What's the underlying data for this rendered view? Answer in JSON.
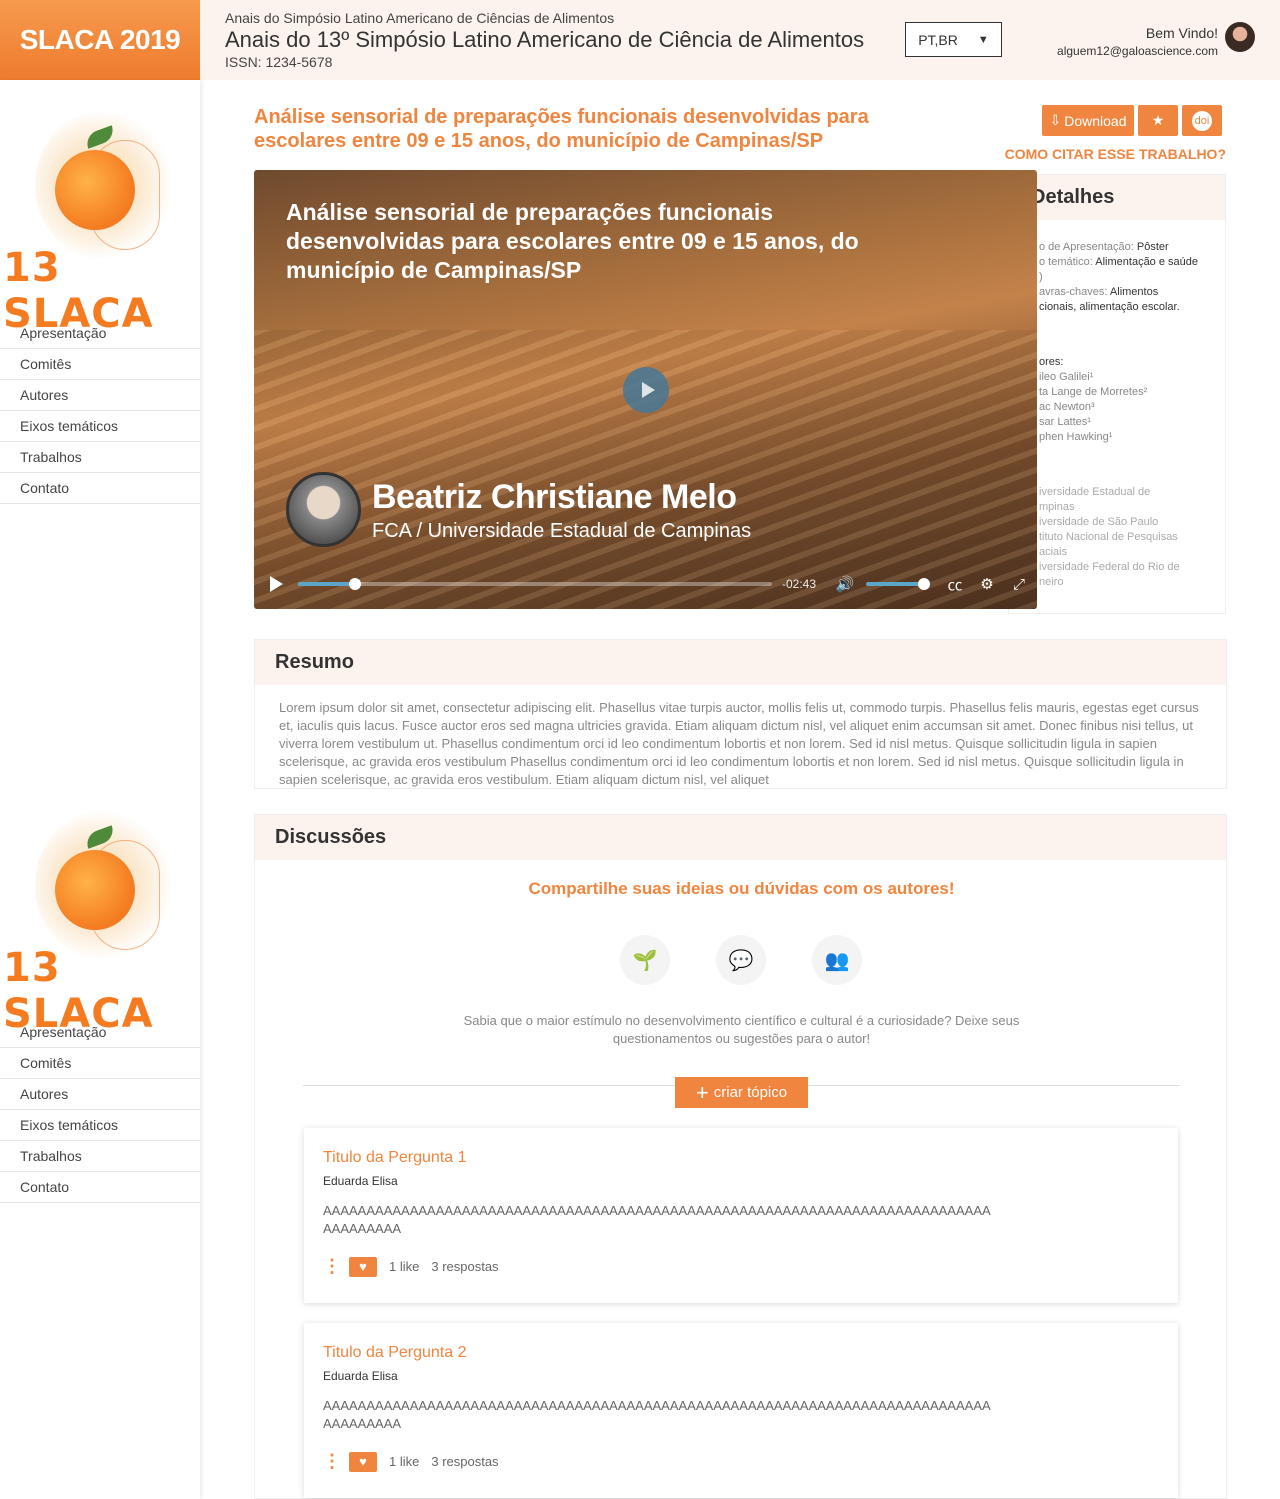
{
  "brand": {
    "name": "SLACA 2019"
  },
  "header": {
    "subtitle": "Anais do Simpósio Latino Americano de Ciências de Alimentos",
    "title": "Anais do 13º Simpósio Latino Americano de Ciência de Alimentos",
    "issn": "ISSN: 1234-5678",
    "language": "PT,BR",
    "welcome": "Bem Vindo!",
    "email": "alguem12@galoascience.com"
  },
  "sidebar": {
    "logo_text": "13 SLACA",
    "nav": [
      "Apresentação",
      "Comitês",
      "Autores",
      "Eixos temáticos",
      "Trabalhos",
      "Contato"
    ]
  },
  "paper": {
    "title": "Análise sensorial de preparações funcionais desenvolvidas para escolares entre 09 e 15 anos, do município de Campinas/SP",
    "download_label": "Download",
    "doi_label": "doi",
    "cite_label": "COMO CITAR ESSE TRABALHO?"
  },
  "details": {
    "title": "Detalhes",
    "line1_label": "o de Apresentação: ",
    "line1_value": "Pôster",
    "line2_label": "o temático: ",
    "line2_value": "Alimentação e saúde",
    "line2b": ")",
    "line3_label": "avras-chaves: ",
    "line3_value": "Alimentos",
    "line3b": "cionais, alimentação escolar.",
    "authors_label": "ores:",
    "authors": [
      "ileo Galilei¹",
      "ta Lange de Morretes²",
      "ac Newton³",
      "sar Lattes¹",
      "phen Hawking¹"
    ],
    "institutions": [
      "iversidade Estadual de",
      "mpinas",
      "iversidade de São Paulo",
      "tituto Nacional de Pesquisas",
      "aciais",
      "iversidade Federal do Rio de",
      "neiro"
    ]
  },
  "video": {
    "title": "Análise sensorial de preparações funcionais desenvolvidas para escolares entre 09 e 15 anos, do município de Campinas/SP",
    "speaker": "Beatriz Christiane Melo",
    "affiliation": "FCA / Universidade Estadual de Campinas",
    "remaining": "-02:43",
    "progress": 0.12,
    "volume": 1.0
  },
  "resumo": {
    "title": "Resumo",
    "text": "Lorem ipsum dolor sit amet, consectetur adipiscing elit. Phasellus vitae turpis auctor, mollis felis ut, commodo turpis. Phasellus felis mauris, egestas eget cursus et, iaculis quis lacus. Fusce auctor eros sed magna ultricies gravida. Etiam aliquam dictum nisl, vel aliquet enim accumsan sit amet. Donec finibus nisi tellus, ut viverra lorem vestibulum ut. Phasellus condimentum orci id leo condimentum lobortis et non lorem. Sed id nisl metus. Quisque sollicitudin ligula in sapien scelerisque, ac gravida eros vestibulum Phasellus condimentum orci id leo condimentum lobortis et non lorem. Sed id nisl metus. Quisque sollicitudin ligula in sapien scelerisque, ac gravida eros vestibulum. Etiam aliquam dictum nisl, vel aliquet"
  },
  "discussions": {
    "title": "Discussões",
    "share": "Compartilhe suas ideias ou dúvidas com os autores!",
    "hint": "Sabia que o maior estímulo no desenvolvimento científico e cultural é a curiosidade? Deixe seus questionamentos ou sugestões para o autor!",
    "create_label": "criar tópico",
    "topics": [
      {
        "title": "Titulo da Pergunta 1",
        "author": "Eduarda Elisa",
        "body": "AAAAAAAAAAAAAAAAAAAAAAAAAAAAAAAAAAAAAAAAAAAAAAAAAAAAAAAAAAAAAAAAAAAAAAAAAAAAAAAAAAAAAA",
        "likes": "1 like",
        "replies": "3 respostas"
      },
      {
        "title": "Titulo da Pergunta 2",
        "author": "Eduarda Elisa",
        "body": "AAAAAAAAAAAAAAAAAAAAAAAAAAAAAAAAAAAAAAAAAAAAAAAAAAAAAAAAAAAAAAAAAAAAAAAAAAAAAAAAAAAAAA",
        "likes": "1 like",
        "replies": "3 respostas"
      }
    ]
  },
  "colors": {
    "accent": "#f0853f",
    "header_bg": "#fdf3ee"
  }
}
